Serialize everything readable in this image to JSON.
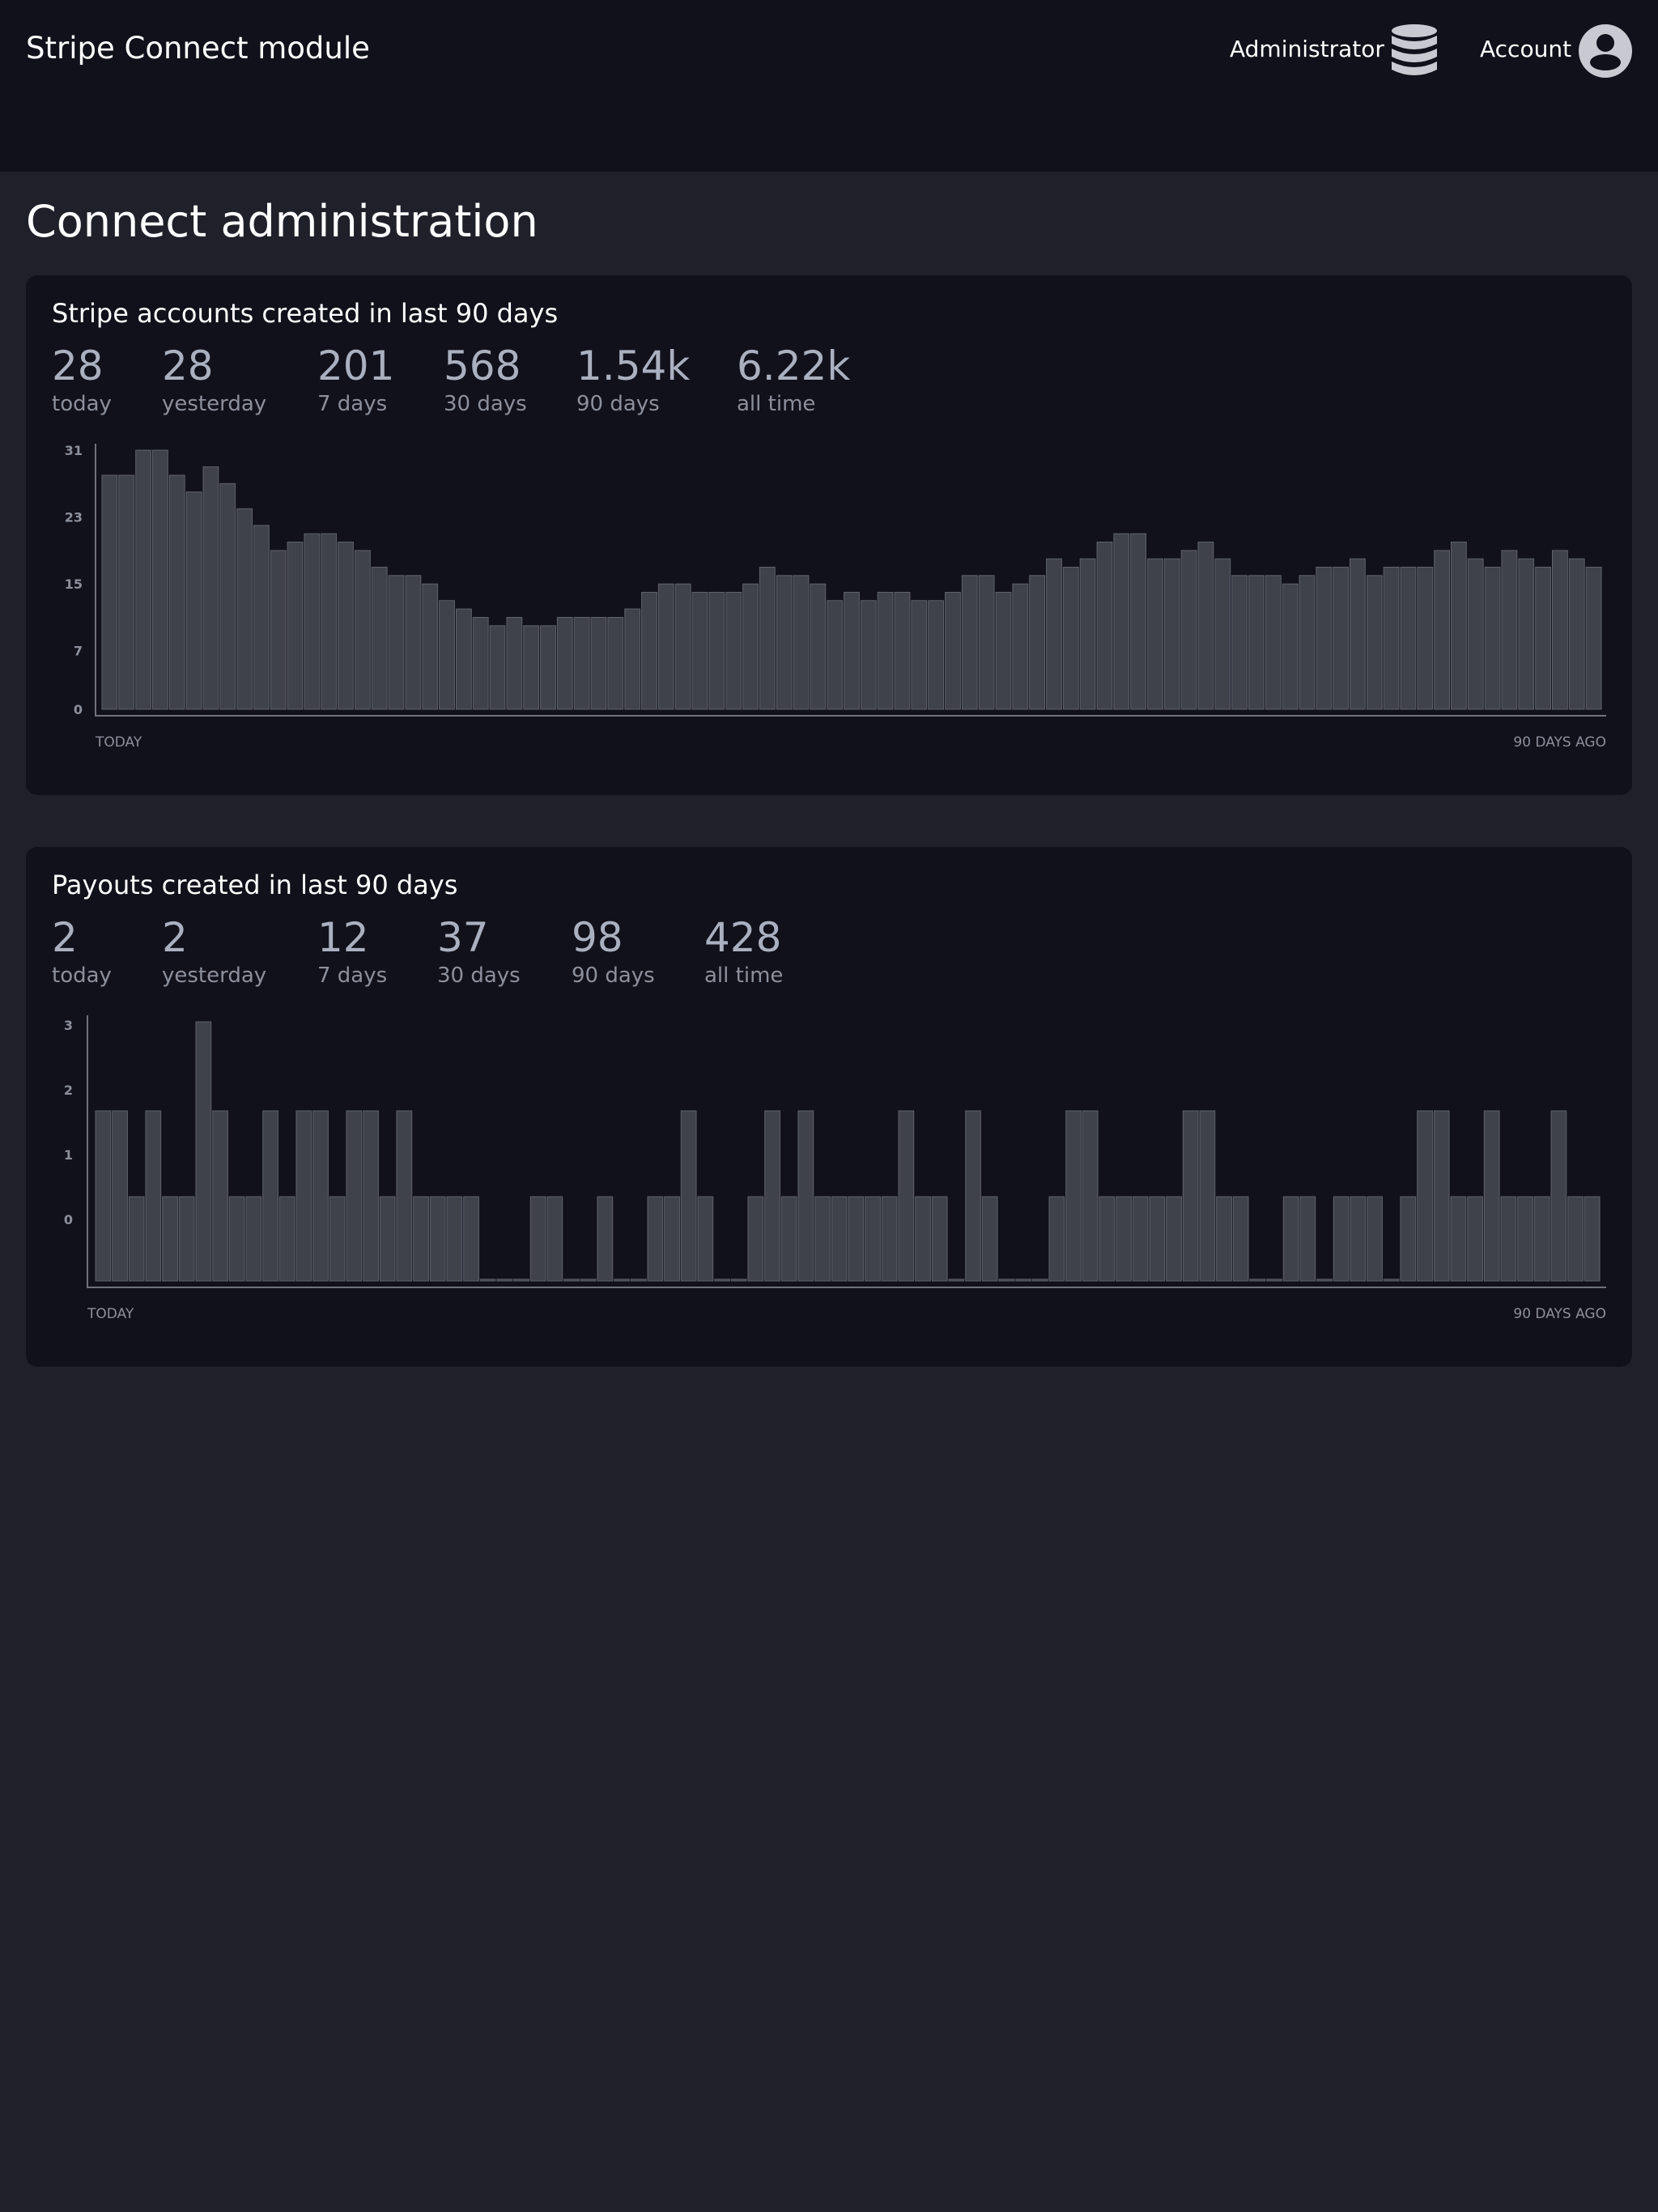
{
  "header": {
    "app_title": "Stripe Connect module",
    "nav": [
      {
        "label": "Administrator",
        "icon": "database-icon"
      },
      {
        "label": "Account",
        "icon": "user-circle-icon"
      }
    ]
  },
  "page": {
    "title": "Connect administration"
  },
  "cards": [
    {
      "title": "Stripe accounts created in last 90 days",
      "stats": [
        {
          "value": "28",
          "label": "today"
        },
        {
          "value": "28",
          "label": "yesterday"
        },
        {
          "value": "201",
          "label": "7 days"
        },
        {
          "value": "568",
          "label": "30 days"
        },
        {
          "value": "1.54k",
          "label": "90 days"
        },
        {
          "value": "6.22k",
          "label": "all time"
        }
      ]
    },
    {
      "title": "Payouts created in last 90 days",
      "stats": [
        {
          "value": "2",
          "label": "today"
        },
        {
          "value": "2",
          "label": "yesterday"
        },
        {
          "value": "12",
          "label": "7 days"
        },
        {
          "value": "37",
          "label": "30 days"
        },
        {
          "value": "98",
          "label": "90 days"
        },
        {
          "value": "428",
          "label": "all time"
        }
      ]
    }
  ],
  "chart_data": [
    {
      "type": "bar",
      "title": "",
      "xlabel": "",
      "ylabel": "",
      "x_start_label": "TODAY",
      "x_end_label": "90 DAYS AGO",
      "y_ticks": [
        0,
        7,
        15,
        23,
        31
      ],
      "ylim": [
        0,
        31
      ],
      "values": [
        28,
        28,
        31,
        31,
        28,
        26,
        29,
        27,
        24,
        22,
        19,
        20,
        21,
        21,
        20,
        19,
        17,
        16,
        16,
        15,
        13,
        12,
        11,
        10,
        11,
        10,
        10,
        11,
        11,
        11,
        11,
        12,
        14,
        15,
        15,
        14,
        14,
        14,
        15,
        17,
        16,
        16,
        15,
        13,
        14,
        13,
        14,
        14,
        13,
        13,
        14,
        16,
        16,
        14,
        15,
        16,
        18,
        17,
        18,
        20,
        21,
        21,
        18,
        18,
        19,
        20,
        18,
        16,
        16,
        16,
        15,
        16,
        17,
        17,
        18,
        16,
        17,
        17,
        17,
        19,
        20,
        18,
        17,
        19,
        18,
        17,
        19,
        18,
        17
      ]
    },
    {
      "type": "bar",
      "title": "",
      "xlabel": "",
      "ylabel": "",
      "x_start_label": "TODAY",
      "x_end_label": "90 DAYS AGO",
      "y_ticks": [
        0,
        1,
        2,
        3
      ],
      "values": [
        2,
        2,
        1,
        2,
        1,
        1,
        3,
        2,
        1,
        1,
        2,
        1,
        2,
        2,
        1,
        2,
        2,
        1,
        2,
        1,
        1,
        1,
        1,
        0,
        0,
        0,
        1,
        1,
        0,
        0,
        1,
        0,
        0,
        1,
        1,
        2,
        1,
        0,
        0,
        1,
        2,
        1,
        2,
        1,
        1,
        1,
        1,
        1,
        2,
        1,
        1,
        0,
        2,
        1,
        0,
        0,
        0,
        1,
        2,
        2,
        1,
        1,
        1,
        1,
        1,
        2,
        2,
        1,
        1,
        0,
        0,
        1,
        1,
        0,
        1,
        1,
        1,
        0,
        1,
        2,
        2,
        1,
        1,
        2,
        1,
        1,
        1,
        2,
        1,
        1
      ]
    }
  ]
}
